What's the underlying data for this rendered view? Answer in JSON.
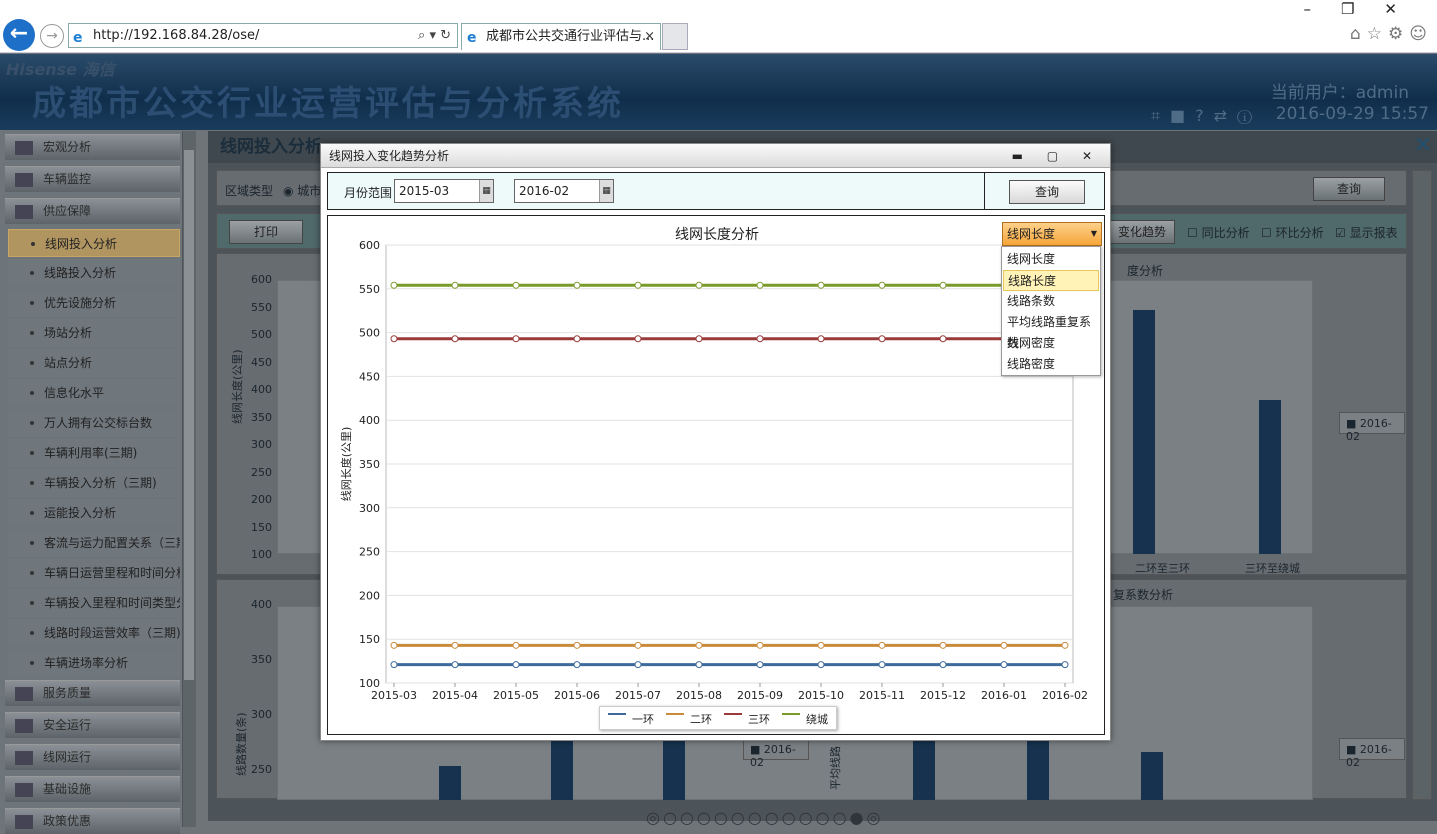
{
  "browser": {
    "url": "http://192.168.84.28/ose/",
    "tab_title": "成都市公共交通行业评估与...",
    "tab_close": "×",
    "back_icon": "←",
    "forward_icon": "→",
    "window_controls": "–❐✕",
    "toolbar_icons": "⌂☆⚙☺"
  },
  "header": {
    "brand": "Hisense 海信",
    "title": "成都市公交行业运营评估与分析系统",
    "user": "当前用户：admin",
    "datetime": "2016-09-29 15:57"
  },
  "sidebar": {
    "sections": [
      {
        "label": "宏观分析"
      },
      {
        "label": "车辆监控"
      },
      {
        "label": "供应保障"
      }
    ],
    "items": [
      {
        "label": "线网投入分析",
        "active": true
      },
      {
        "label": "线路投入分析"
      },
      {
        "label": "优先设施分析"
      },
      {
        "label": "场站分析"
      },
      {
        "label": "站点分析"
      },
      {
        "label": "信息化水平"
      },
      {
        "label": "万人拥有公交标台数"
      },
      {
        "label": "车辆利用率(三期)"
      },
      {
        "label": "车辆投入分析（三期)"
      },
      {
        "label": "运能投入分析"
      },
      {
        "label": "客流与运力配置关系（三期)"
      },
      {
        "label": "车辆日运营里程和时间分析"
      },
      {
        "label": "车辆投入里程和时间类型分析"
      },
      {
        "label": "线路时段运营效率（三期)"
      },
      {
        "label": "车辆进场率分析"
      }
    ],
    "bottom_sections": [
      {
        "label": "服务质量"
      },
      {
        "label": "安全运行"
      },
      {
        "label": "线网运行"
      },
      {
        "label": "基础设施"
      },
      {
        "label": "政策优惠"
      }
    ]
  },
  "main": {
    "title": "线网投入分析",
    "area_type_label": "区域类型",
    "area_option": "城市",
    "query": "查询",
    "print": "打印",
    "trend_btn": "变化趋势",
    "chk_yoy": "同比分析",
    "chk_mom": "环比分析",
    "chk_report": "显示报表",
    "bg_chart1_title": "度分析",
    "bg_chart2_title": "复系数分析",
    "bg_legend": "2016-02",
    "bg_cat1": "二环至三环",
    "bg_cat2": "三环至绕城",
    "bg_ylabel": "线网长度(公里)",
    "bg_ylabel2": "线路数量(条)",
    "bg_ylabel3": "平均线路",
    "bg_yticks": [
      "600",
      "550",
      "500",
      "450",
      "400",
      "350",
      "300",
      "250",
      "200",
      "150",
      "100"
    ],
    "bg_yticks2": [
      "400",
      "350",
      "300",
      "250"
    ]
  },
  "modal": {
    "title": "线网投入变化趋势分析",
    "controls": "▬ ▢ ✕",
    "month_range_label": "月份范围",
    "start_month": "2015-03",
    "end_month": "2016-02",
    "dash": "--",
    "calendar_icon": "▦",
    "query": "查询",
    "metric_select": "线网长度",
    "metric_options": [
      "线网长度",
      "线路长度",
      "线路条数",
      "平均线路重复系数",
      "线网密度",
      "线路密度"
    ],
    "highlighted_option": 1
  },
  "chart_data": {
    "type": "line",
    "title": "线网长度分析",
    "ylabel": "线网长度(公里)",
    "xlabel": "",
    "ylim": [
      100,
      600
    ],
    "yticks": [
      100,
      150,
      200,
      250,
      300,
      350,
      400,
      450,
      500,
      550,
      600
    ],
    "x": [
      "2015-03",
      "2015-04",
      "2015-05",
      "2015-06",
      "2015-07",
      "2015-08",
      "2015-09",
      "2015-10",
      "2015-11",
      "2015-12",
      "2016-01",
      "2016-02"
    ],
    "grid": true,
    "legend": "bottom",
    "series": [
      {
        "name": "一环",
        "color": "#3d6a9a",
        "values": [
          121,
          121,
          121,
          121,
          121,
          121,
          121,
          121,
          121,
          121,
          121,
          121
        ]
      },
      {
        "name": "二环",
        "color": "#c98a3a",
        "values": [
          143,
          143,
          143,
          143,
          143,
          143,
          143,
          143,
          143,
          143,
          143,
          143
        ]
      },
      {
        "name": "三环",
        "color": "#9a3a3a",
        "values": [
          493,
          493,
          493,
          493,
          493,
          493,
          493,
          493,
          493,
          493,
          493,
          493
        ]
      },
      {
        "name": "绕城",
        "color": "#7a9a2a",
        "values": [
          554,
          554,
          554,
          554,
          554,
          554,
          554,
          554,
          554,
          554,
          554,
          554
        ]
      }
    ]
  }
}
